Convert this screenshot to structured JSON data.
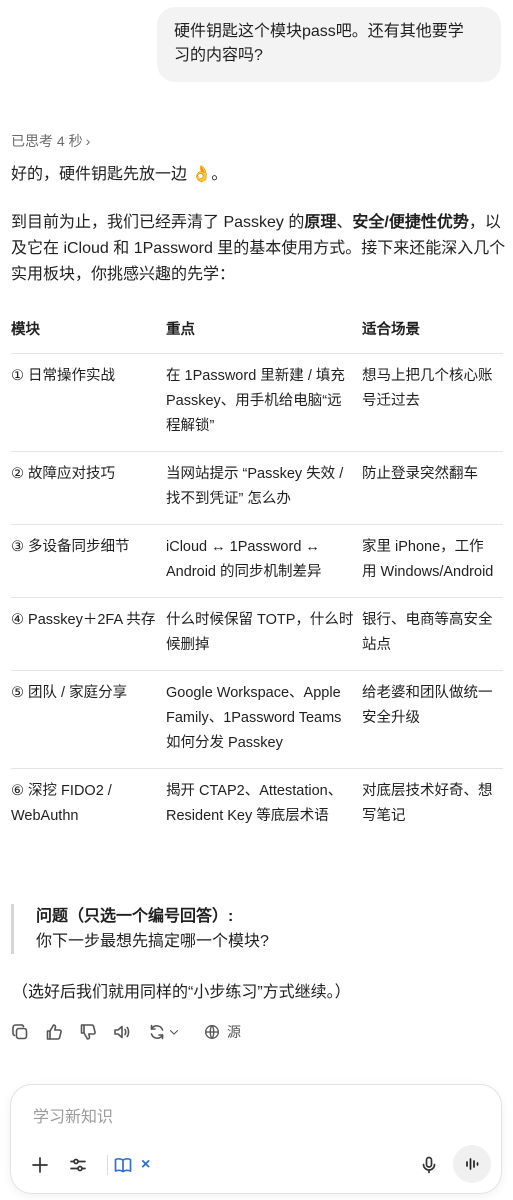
{
  "user_message": {
    "line1": "硬件钥匙这个模块pass吧。还有其他要学",
    "line2": "习的内容吗?"
  },
  "thought_label": "已思考 4 秒",
  "intro1": "好的，硬件钥匙先放一边 👌。",
  "intro2": {
    "part1": "到目前为止，我们已经弄清了 Passkey 的",
    "bold1": "原理",
    "part2": "、",
    "bold2": "安全/便捷性优势",
    "part3": "，以及它在 iCloud 和 1Password 里的基本使用方式。接下来还能深入几个实用板块，你挑感兴趣的先学："
  },
  "table": {
    "headers": [
      "模块",
      "重点",
      "适合场景"
    ],
    "rows": [
      {
        "module": "① 日常操作实战",
        "focus": "在 1Password 里新建 / 填充 Passkey、用手机给电脑“远程解锁”",
        "scene": "想马上把几个核心账号迁过去"
      },
      {
        "module": "② 故障应对技巧",
        "focus": "当网站提示 “Passkey 失效 / 找不到凭证” 怎么办",
        "scene": "防止登录突然翻车"
      },
      {
        "module": "③ 多设备同步细节",
        "focus": "iCloud ↔ 1Password ↔ Android 的同步机制差异",
        "scene": "家里 iPhone，工作用 Windows/Android"
      },
      {
        "module": "④ Passkey＋2FA 共存",
        "focus": "什么时候保留 TOTP，什么时候删掉",
        "scene": "银行、电商等高安全站点"
      },
      {
        "module": "⑤ 团队 / 家庭分享",
        "focus": "Google Workspace、Apple Family、1Password Teams 如何分发 Passkey",
        "scene": "给老婆和团队做统一安全升级"
      },
      {
        "module": "⑥ 深挖 FIDO2 / WebAuthn",
        "focus": "揭开 CTAP2、Attestation、Resident Key 等底层术语",
        "scene": "对底层技术好奇、想写笔记"
      }
    ]
  },
  "question": {
    "title": "问题（只选一个编号回答）:",
    "body": "你下一步最想先搞定哪一个模块?"
  },
  "footer_note": "（选好后我们就用同样的“小步练习”方式继续。）",
  "actions": {
    "icons": [
      "copy-icon",
      "thumbs-up-icon",
      "thumbs-down-icon",
      "speaker-icon",
      "regenerate-icon",
      "globe-icon"
    ],
    "source_label": "源"
  },
  "composer": {
    "placeholder": "学习新知识",
    "icons": [
      "plus-icon",
      "sliders-icon",
      "book-icon",
      "close-icon",
      "mic-icon",
      "voice-wave-icon"
    ]
  },
  "colors": {
    "accent_blue": "#2f6fd6",
    "bubble_bg": "#f3f3f3",
    "text": "#1f1f1f",
    "muted": "#6b6b6b"
  }
}
